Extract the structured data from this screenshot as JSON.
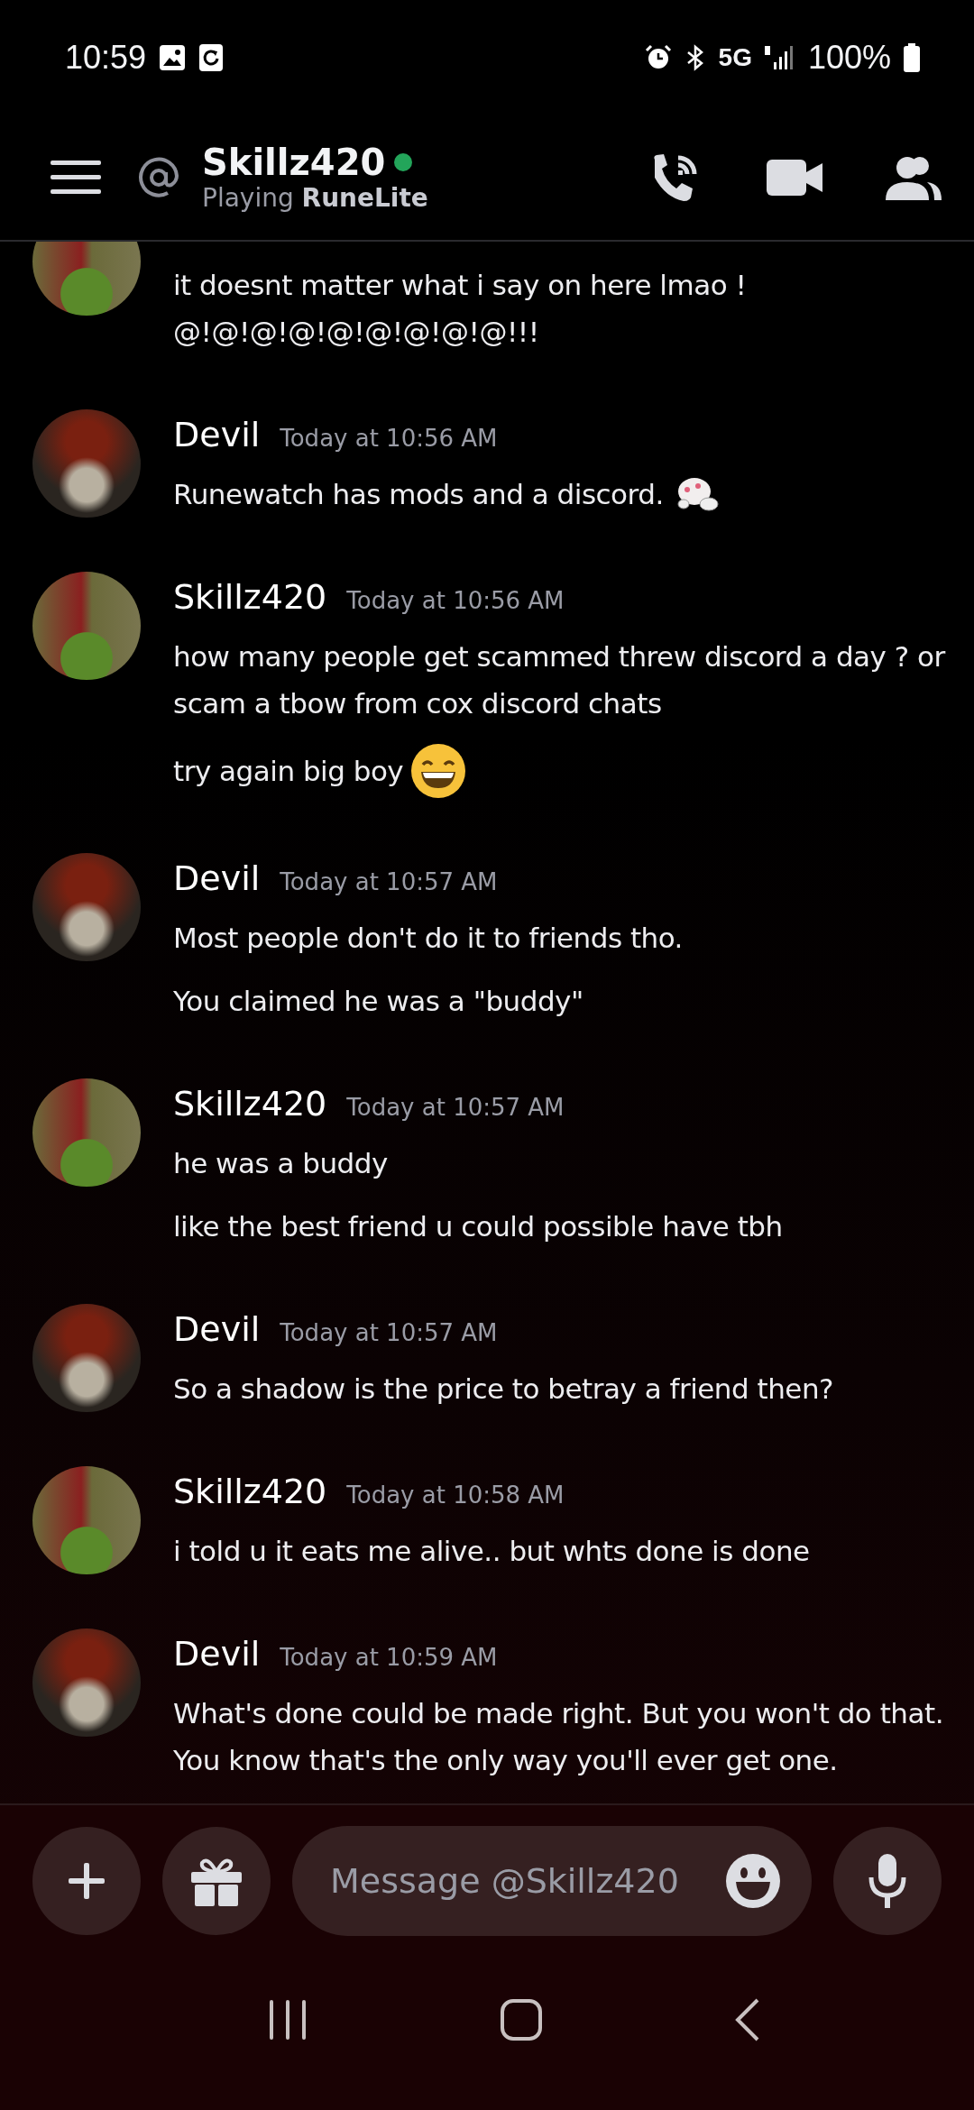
{
  "status_bar": {
    "time": "10:59",
    "network": "5G",
    "battery": "100%"
  },
  "header": {
    "title": "Skillz420",
    "online": true,
    "subtitle": "Playing **RuneLite**"
  },
  "groups": [
    {
      "kind": "skillz",
      "messages": [
        {
          "text": "it doesnt matter what i say on here lmao ! @!@!@!@!@!@!@!@!@!!!"
        }
      ]
    },
    {
      "author": "Devil",
      "time": "Today at 10:56 AM",
      "kind": "devil",
      "messages": [
        {
          "text": "Runewatch has mods and a discord.",
          "kind": "sticker"
        }
      ]
    },
    {
      "author": "Skillz420",
      "time": "Today at 10:56 AM",
      "kind": "skillz",
      "messages": [
        {
          "text": "how many people get scammed threw discord a day ? or scam a tbow from cox discord chats",
          "kind": "plain"
        },
        {
          "text": "try again big boy",
          "kind": "grin"
        }
      ]
    },
    {
      "author": "Devil",
      "time": "Today at 10:57 AM",
      "kind": "devil",
      "messages": [
        {
          "text": "Most people don't do it to friends tho."
        },
        {
          "text": "You claimed he was a \"buddy\""
        }
      ]
    },
    {
      "author": "Skillz420",
      "time": "Today at 10:57 AM",
      "kind": "skillz",
      "messages": [
        {
          "text": "he was a buddy"
        },
        {
          "text": "like the best friend u could possible have tbh"
        }
      ]
    },
    {
      "author": "Devil",
      "time": "Today at 10:57 AM",
      "kind": "devil",
      "messages": [
        {
          "text": "So a shadow is the price to betray a friend then?"
        }
      ]
    },
    {
      "author": "Skillz420",
      "time": "Today at 10:58 AM",
      "kind": "skillz",
      "messages": [
        {
          "text": "i told u it eats me alive.. but whts done is done"
        }
      ]
    },
    {
      "author": "Devil",
      "time": "Today at 10:59 AM",
      "kind": "devil",
      "messages": [
        {
          "text": "What's done could be made right. But you won't do that. You know that's the only way you'll ever get one."
        }
      ]
    }
  ],
  "composer": {
    "placeholder": "Message @Skillz420"
  }
}
